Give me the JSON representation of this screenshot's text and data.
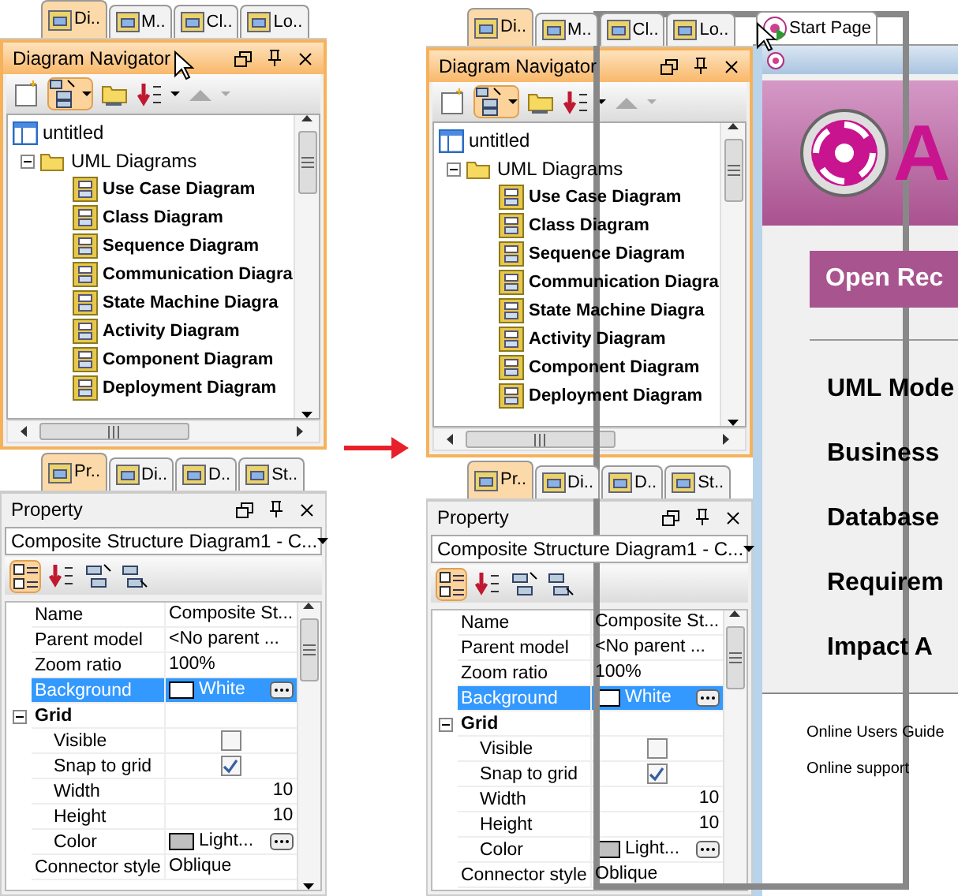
{
  "before": {
    "navigator": {
      "tabs": [
        {
          "label": "Di..",
          "selected": true
        },
        {
          "label": "M..",
          "selected": false
        },
        {
          "label": "Cl..",
          "selected": false
        },
        {
          "label": "Lo..",
          "selected": false
        }
      ],
      "title": "Diagram Navigator",
      "tree": {
        "label": "untitled",
        "children": [
          {
            "label": "UML Diagrams",
            "expanded": true,
            "children": [
              {
                "label": "Use Case Diagram"
              },
              {
                "label": "Class Diagram"
              },
              {
                "label": "Sequence Diagram"
              },
              {
                "label": "Communication Diagra"
              },
              {
                "label": "State Machine Diagra"
              },
              {
                "label": "Activity Diagram"
              },
              {
                "label": "Component Diagram"
              },
              {
                "label": "Deployment Diagram"
              }
            ]
          }
        ]
      }
    },
    "property": {
      "tabs": [
        {
          "label": "Pr..",
          "selected": true
        },
        {
          "label": "Di..",
          "selected": false
        },
        {
          "label": "D..",
          "selected": false
        },
        {
          "label": "St..",
          "selected": false
        }
      ],
      "title": "Property",
      "selector": "Composite Structure Diagram1 - C...",
      "rows": [
        {
          "kind": "text",
          "name": "Name",
          "value": "Composite St...",
          "selected": false
        },
        {
          "kind": "text",
          "name": "Parent model",
          "value": "<No parent ...",
          "selected": false
        },
        {
          "kind": "text",
          "name": "Zoom ratio",
          "value": "100%",
          "selected": false
        },
        {
          "kind": "color",
          "name": "Background",
          "value": "White",
          "color": "#ffffff",
          "selected": true
        },
        {
          "kind": "group",
          "name": "Grid",
          "expanded": true,
          "selected": false,
          "children": [
            {
              "kind": "check",
              "name": "Visible",
              "checked": false,
              "selected": false
            },
            {
              "kind": "check",
              "name": "Snap to grid",
              "checked": true,
              "selected": false
            },
            {
              "kind": "number",
              "name": "Width",
              "value": "10",
              "selected": false
            },
            {
              "kind": "number",
              "name": "Height",
              "value": "10",
              "selected": false
            },
            {
              "kind": "color",
              "name": "Color",
              "value": "Light...",
              "color": "#c0c0c0",
              "selected": false
            }
          ]
        },
        {
          "kind": "text",
          "name": "Connector style",
          "value": "Oblique",
          "selected": false
        }
      ]
    }
  },
  "after": {
    "navigator": {
      "tabs": [
        {
          "label": "Di..",
          "selected": true
        },
        {
          "label": "M..",
          "selected": false
        },
        {
          "label": "Cl..",
          "selected": false
        },
        {
          "label": "Lo..",
          "selected": false
        }
      ],
      "title": "Diagram Navigator",
      "tree": {
        "label": "untitled",
        "children": [
          {
            "label": "UML Diagrams",
            "expanded": true,
            "children": [
              {
                "label": "Use Case Diagram"
              },
              {
                "label": "Class Diagram"
              },
              {
                "label": "Sequence Diagram"
              },
              {
                "label": "Communication Diagra"
              },
              {
                "label": "State Machine Diagra"
              },
              {
                "label": "Activity Diagram"
              },
              {
                "label": "Component Diagram"
              },
              {
                "label": "Deployment Diagram"
              }
            ]
          }
        ]
      }
    },
    "property": {
      "tabs": [
        {
          "label": "Pr..",
          "selected": true
        },
        {
          "label": "Di..",
          "selected": false
        },
        {
          "label": "D..",
          "selected": false
        },
        {
          "label": "St..",
          "selected": false
        }
      ],
      "title": "Property",
      "selector": "Composite Structure Diagram1 - C...",
      "rows": [
        {
          "kind": "text",
          "name": "Name",
          "value": "Composite St...",
          "selected": false
        },
        {
          "kind": "text",
          "name": "Parent model",
          "value": "<No parent ...",
          "selected": false
        },
        {
          "kind": "text",
          "name": "Zoom ratio",
          "value": "100%",
          "selected": false
        },
        {
          "kind": "color",
          "name": "Background",
          "value": "White",
          "color": "#ffffff",
          "selected": true
        },
        {
          "kind": "group",
          "name": "Grid",
          "expanded": true,
          "selected": false,
          "children": [
            {
              "kind": "check",
              "name": "Visible",
              "checked": false,
              "selected": false
            },
            {
              "kind": "check",
              "name": "Snap to grid",
              "checked": true,
              "selected": false
            },
            {
              "kind": "number",
              "name": "Width",
              "value": "10",
              "selected": false
            },
            {
              "kind": "number",
              "name": "Height",
              "value": "10",
              "selected": false
            },
            {
              "kind": "color",
              "name": "Color",
              "value": "Light...",
              "color": "#c0c0c0",
              "selected": false
            }
          ]
        },
        {
          "kind": "text",
          "name": "Connector style",
          "value": "Oblique",
          "selected": false
        }
      ]
    },
    "start_page": {
      "tab": "Start Page",
      "logo_text": "A",
      "open_button": "Open Rec",
      "sections": [
        "UML Mode",
        "Business",
        "Database",
        "Requirem",
        "Impact A"
      ],
      "links": [
        "Online Users Guide",
        "Online support"
      ]
    }
  }
}
